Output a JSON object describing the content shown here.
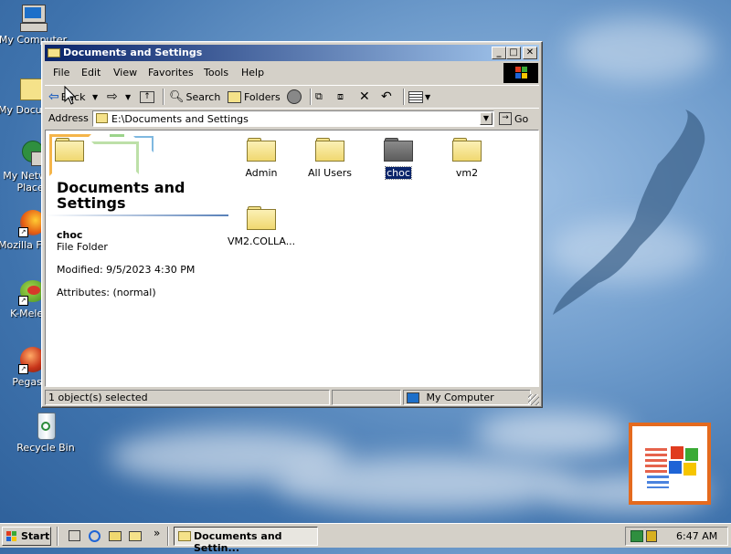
{
  "desktop": {
    "icons": [
      {
        "label": "My Computer"
      },
      {
        "label": "My Documents"
      },
      {
        "label": "My Network Places"
      },
      {
        "label": "Mozilla Firefox"
      },
      {
        "label": "K-Meleon"
      },
      {
        "label": "Pegasus"
      },
      {
        "label": "Recycle Bin"
      }
    ]
  },
  "window": {
    "title": "Documents and Settings",
    "menu": [
      "File",
      "Edit",
      "View",
      "Favorites",
      "Tools",
      "Help"
    ],
    "toolbar": {
      "back_label": "Back",
      "search_label": "Search",
      "folders_label": "Folders"
    },
    "address": {
      "label": "Address",
      "value": "E:\\Documents and Settings",
      "go_label": "Go"
    },
    "left_panel": {
      "heading": "Documents and Settings",
      "selected_name": "choc",
      "selected_type": "File Folder",
      "modified": "Modified: 9/5/2023 4:30 PM",
      "attributes": "Attributes: (normal)"
    },
    "items": [
      {
        "name": "Admin",
        "selected": false
      },
      {
        "name": "All Users",
        "selected": false
      },
      {
        "name": "choc",
        "selected": true
      },
      {
        "name": "vm2",
        "selected": false
      },
      {
        "name": "VM2.COLLA...",
        "selected": false
      }
    ],
    "status": {
      "selection": "1 object(s) selected",
      "zone": "My Computer"
    }
  },
  "taskbar": {
    "start_label": "Start",
    "task_label": "Documents and Settin...",
    "clock": "6:47 AM"
  },
  "colors": {
    "title_start": "#0a246a",
    "title_end": "#a6caf0",
    "selection": "#0a246a",
    "folder": "#f5e28a"
  }
}
